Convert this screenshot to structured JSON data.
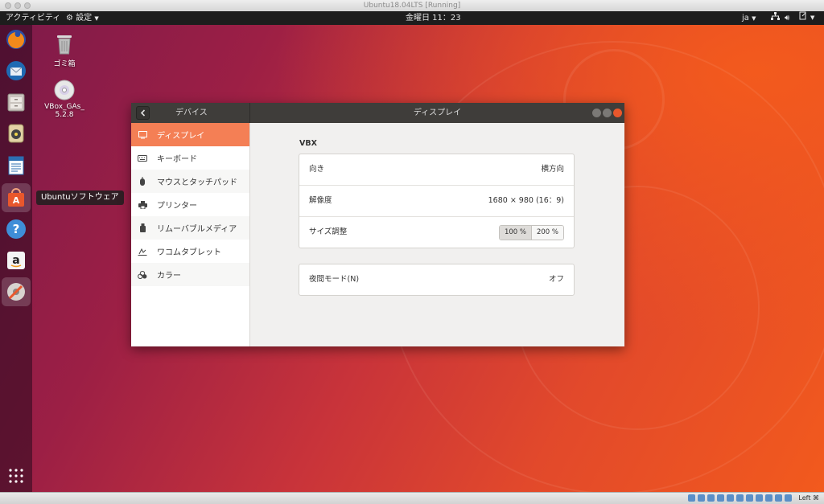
{
  "host": {
    "title": "Ubuntu18.04LTS [Running]",
    "host_key": "Left ⌘"
  },
  "topbar": {
    "activities": "アクティビティ",
    "app_menu": "設定",
    "clock": "金曜日 11：23",
    "lang": "ja"
  },
  "dock": {
    "tooltip": "Ubuntuソフトウェア"
  },
  "desktop": {
    "trash_label": "ゴミ箱",
    "disc_label_1": "VBox_GAs_",
    "disc_label_2": "5.2.8"
  },
  "settings": {
    "sidebar_header": "デバイス",
    "window_title": "ディスプレイ",
    "nav": [
      {
        "label": "ディスプレイ"
      },
      {
        "label": "キーボード"
      },
      {
        "label": "マウスとタッチパッド"
      },
      {
        "label": "プリンター"
      },
      {
        "label": "リムーバブルメディア"
      },
      {
        "label": "ワコムタブレット"
      },
      {
        "label": "カラー"
      }
    ],
    "monitor_name": "VBX",
    "orientation": {
      "label": "向き",
      "value": "横方向"
    },
    "resolution": {
      "label": "解像度",
      "value": "1680 × 980 (16：9)"
    },
    "scale": {
      "label": "サイズ調整",
      "option_100": "100 %",
      "option_200": "200 %"
    },
    "night_light": {
      "label": "夜間モード(N)",
      "value": "オフ"
    }
  },
  "colors": {
    "accent": "#f47f55",
    "header": "#3f3d3a",
    "close": "#e9572c"
  }
}
